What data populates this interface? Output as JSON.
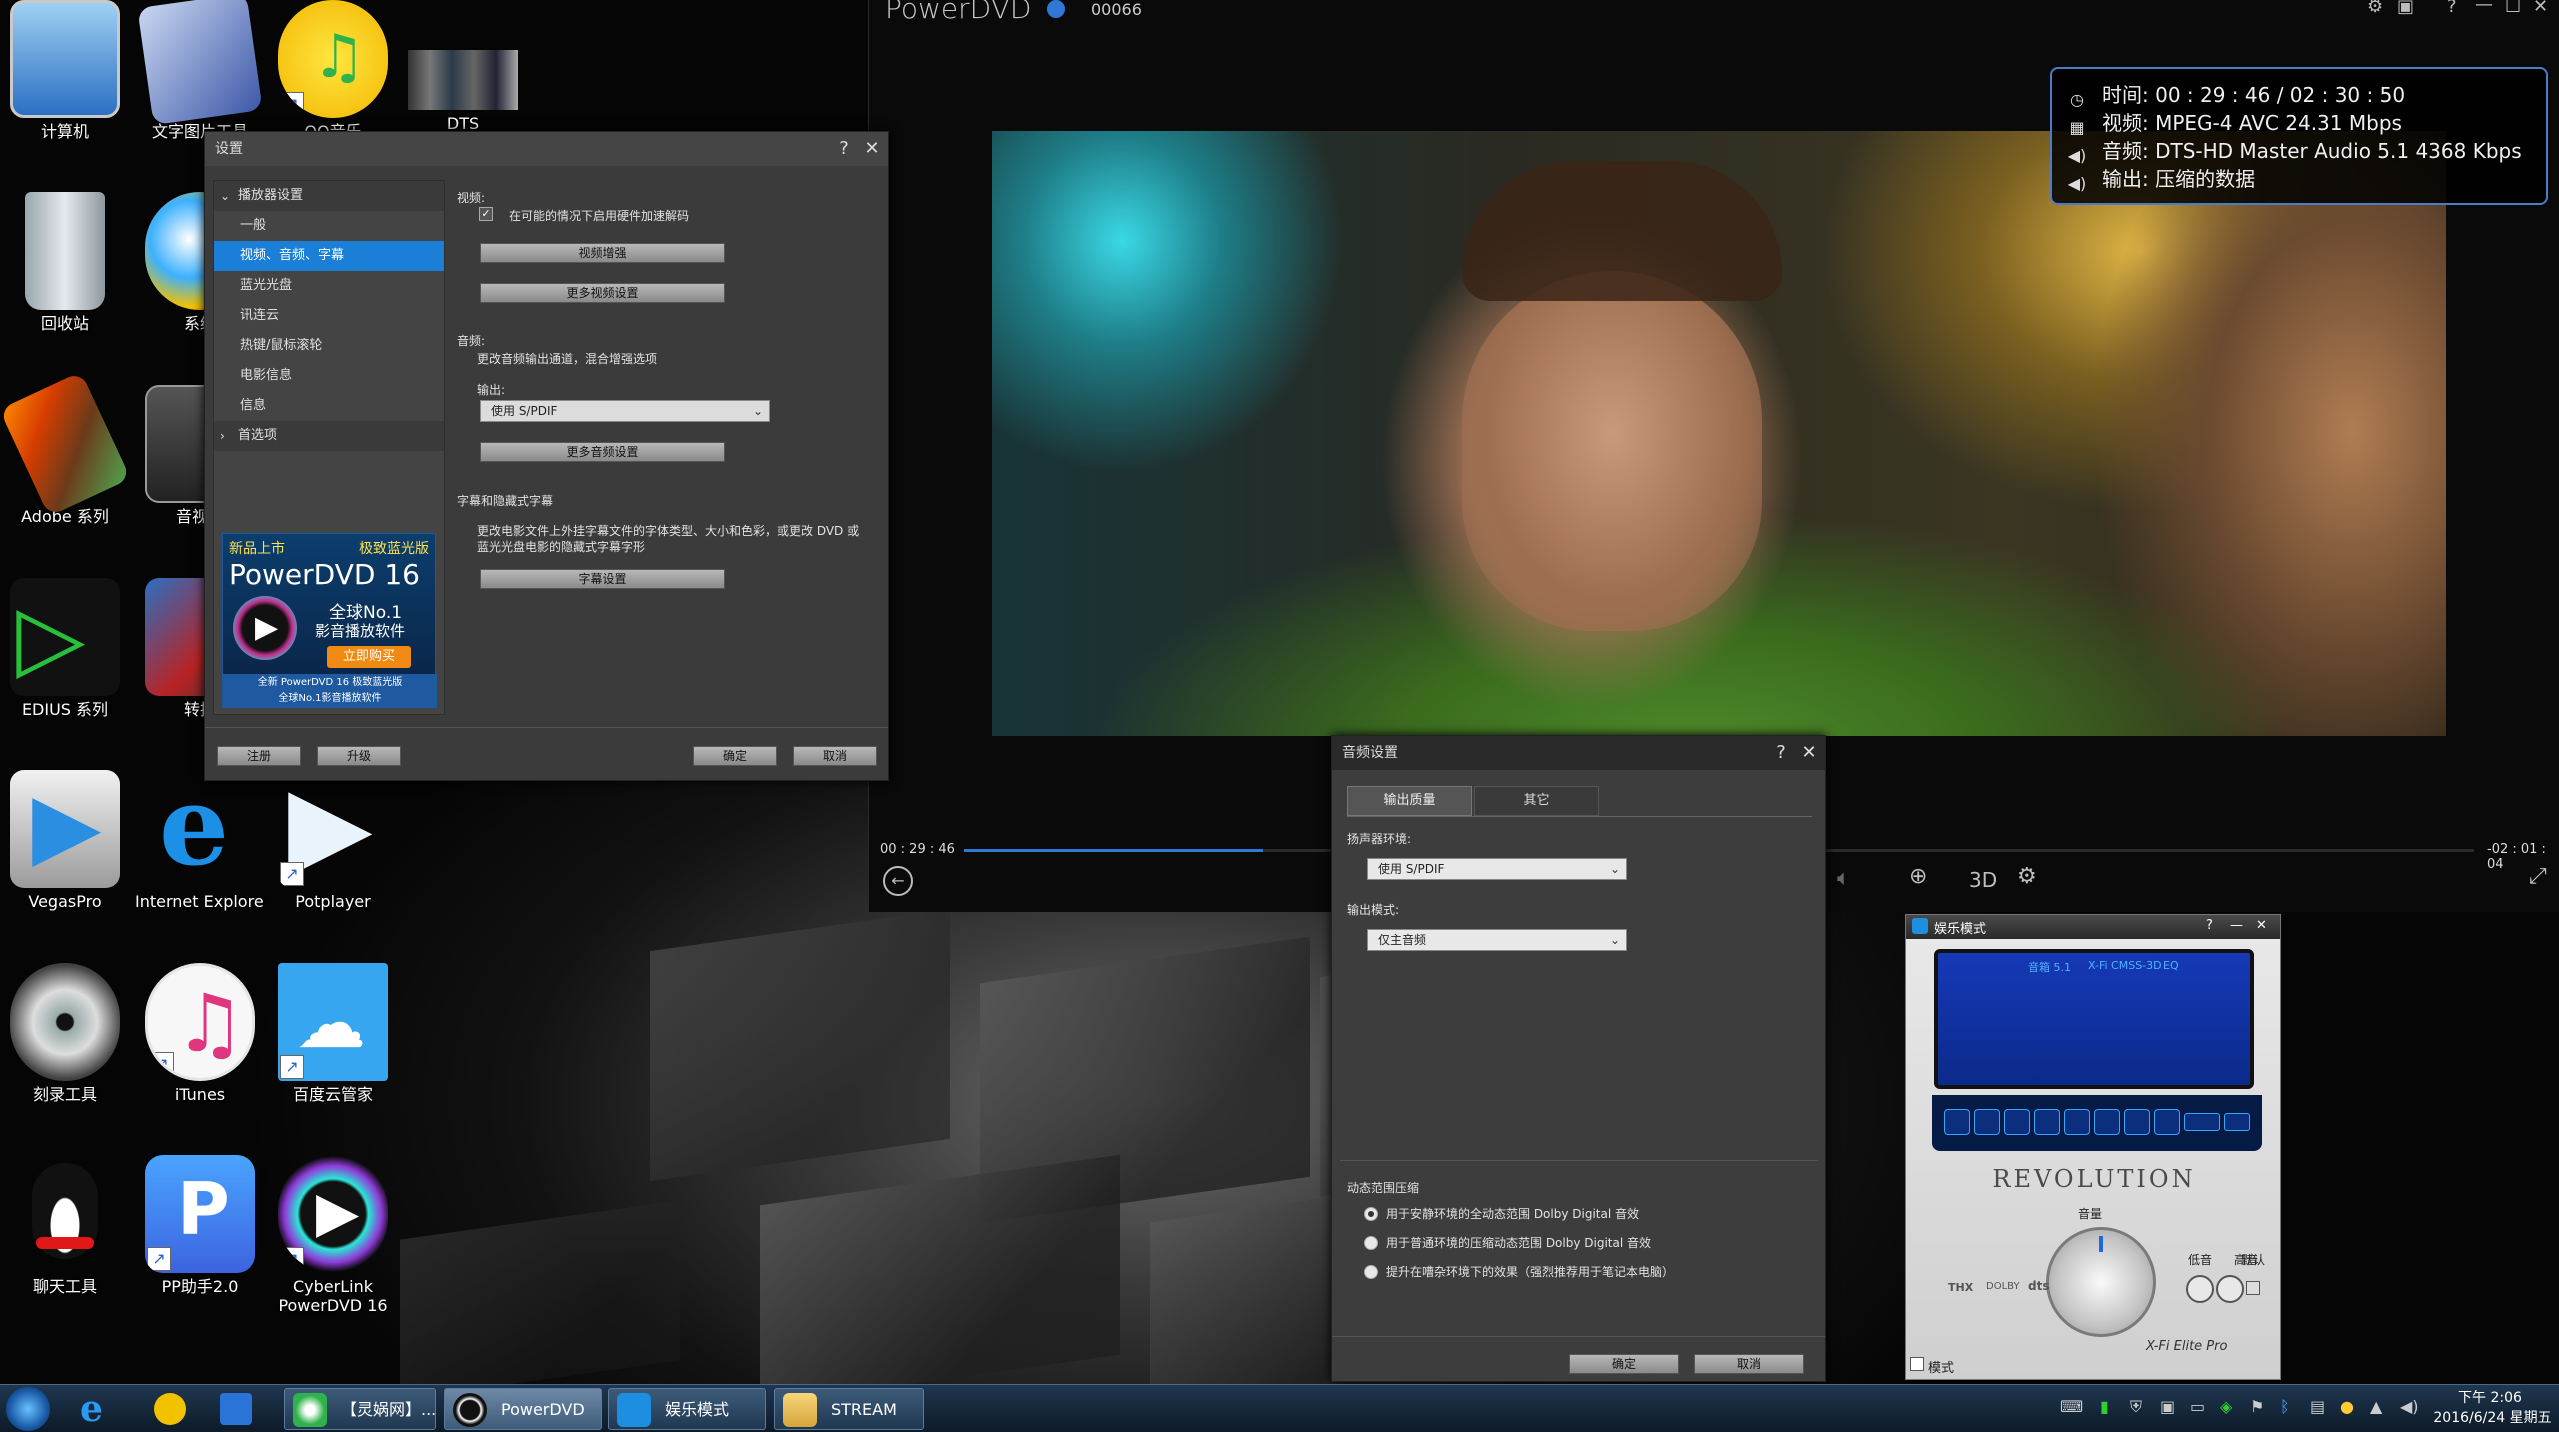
{
  "desktop": {
    "icons": [
      {
        "label": "计算机",
        "name": "computer"
      },
      {
        "label": "文字图片工具",
        "name": "text-image-tools"
      },
      {
        "label": "QQ音乐",
        "name": "qq-music"
      },
      {
        "label": "DTS",
        "name": "dts"
      },
      {
        "label": "回收站",
        "name": "recycle-bin"
      },
      {
        "label": "系统",
        "name": "system"
      },
      {
        "label": "Adobe 系列",
        "name": "adobe-series"
      },
      {
        "label": "音视频",
        "name": "audio-video"
      },
      {
        "label": "EDIUS 系列",
        "name": "edius-series"
      },
      {
        "label": "转换",
        "name": "convert"
      },
      {
        "label": "VegasPro",
        "name": "vegaspro"
      },
      {
        "label": "Internet Explorer",
        "name": "internet-explorer"
      },
      {
        "label": "Potplayer",
        "name": "potplayer"
      },
      {
        "label": "刻录工具",
        "name": "burn-tools"
      },
      {
        "label": "iTunes",
        "name": "itunes"
      },
      {
        "label": "百度云管家",
        "name": "baidu-cloud"
      },
      {
        "label": "聊天工具",
        "name": "chat-tools"
      },
      {
        "label": "PP助手2.0",
        "name": "pp-assistant"
      },
      {
        "label": "CyberLink",
        "name": "cyberlink-line1"
      },
      {
        "label": "PowerDVD 16",
        "name": "cyberlink-line2"
      }
    ]
  },
  "player": {
    "app_title": "PowerDVD",
    "counter": "00066",
    "info": {
      "time": "时间: 00 : 29 : 46 / 02 : 30 : 50",
      "video": "视频: MPEG-4 AVC  24.31 Mbps",
      "audio": "音频: DTS-HD Master Audio 5.1  4368 Kbps",
      "output": "输出: 压缩的数据"
    },
    "elapsed": "00 : 29 : 46",
    "remaining": "-02 : 01 : 04",
    "progress_fraction": 0.198,
    "btn_3d": "3D"
  },
  "settings": {
    "title": "设置",
    "help": "?",
    "close": "✕",
    "nav": [
      {
        "label": "播放器设置",
        "expandable": true,
        "selected": false,
        "indent": false
      },
      {
        "label": "一般",
        "selected": false,
        "indent": true
      },
      {
        "label": "视频、音频、字幕",
        "selected": true,
        "indent": true
      },
      {
        "label": "蓝光光盘",
        "selected": false,
        "indent": true
      },
      {
        "label": "讯连云",
        "selected": false,
        "indent": true
      },
      {
        "label": "热键/鼠标滚轮",
        "selected": false,
        "indent": true
      },
      {
        "label": "电影信息",
        "selected": false,
        "indent": true
      },
      {
        "label": "信息",
        "selected": false,
        "indent": true
      },
      {
        "label": "首选项",
        "expandable": true,
        "selected": false,
        "indent": false
      }
    ],
    "ad": {
      "tag_new": "新品上市",
      "tag_ultimate": "极致蓝光版",
      "product": "PowerDVD 16",
      "line1": "全球No.1",
      "line2": "影音播放软件",
      "buy": "立即购买",
      "footer1": "全新 PowerDVD 16 极致蓝光版",
      "footer2": "全球No.1影音播放软件"
    },
    "video_section": "视频:",
    "hw_accel_label": "在可能的情况下启用硬件加速解码",
    "hw_accel_checked": true,
    "video_enhance_btn": "视频增强",
    "more_video_btn": "更多视频设置",
    "audio_section": "音频:",
    "audio_desc": "更改音频输出通道，混合增强选项",
    "output_label": "输出:",
    "output_value": "使用 S/PDIF",
    "more_audio_btn": "更多音频设置",
    "subtitle_section": "字幕和隐藏式字幕",
    "subtitle_desc1": "更改电影文件上外挂字幕文件的字体类型、大小和色彩，或更改 DVD 或",
    "subtitle_desc2": "蓝光光盘电影的隐藏式字幕字形",
    "subtitle_btn": "字幕设置",
    "register_btn": "注册",
    "upgrade_btn": "升级",
    "ok_btn": "确定",
    "cancel_btn": "取消"
  },
  "audio_dialog": {
    "title": "音频设置",
    "help": "?",
    "close": "✕",
    "tabs": [
      "输出质量",
      "其它"
    ],
    "active_tab": 0,
    "speaker_label": "扬声器环境:",
    "speaker_value": "使用 S/PDIF",
    "mode_label": "输出模式:",
    "mode_value": "仅主音频",
    "drc_label": "动态范围压缩",
    "drc_options": [
      "用于安静环境的全动态范围 Dolby Digital 音效",
      "用于普通环境的压缩动态范围 Dolby Digital 音效",
      "提升在嘈杂环境下的效果（强烈推荐用于笔记本电脑）"
    ],
    "drc_selected": 0,
    "ok_btn": "确定",
    "cancel_btn": "取消"
  },
  "creative": {
    "title": "娱乐模式",
    "help": "?",
    "minimize": "—",
    "close": "✕",
    "status": [
      "音箱 5.1",
      "X-Fi CMSS-3D",
      "EQ"
    ],
    "brand": "REVOLUTION",
    "volume_label": "音量",
    "bass_label": "低音",
    "treble_label": "高音",
    "default_label": "默认",
    "mode_label": "模式",
    "logos": [
      "THX",
      "DOLBY",
      "dts"
    ],
    "model": "X-Fi Elite Pro"
  },
  "taskbar": {
    "items": [
      {
        "label": "【灵娲网】...",
        "name": "task-browser"
      },
      {
        "label": "PowerDVD",
        "name": "task-powerdvd"
      },
      {
        "label": "娱乐模式",
        "name": "task-entertainment"
      },
      {
        "label": "STREAM",
        "name": "task-stream"
      }
    ],
    "time": "下午 2:06",
    "date": "2016/6/24 星期五"
  },
  "colors": {
    "accent": "#1b7fd8",
    "progress": "#2f78d6",
    "info_border": "#4b7cc8",
    "lcd": "#0b2f9b"
  }
}
